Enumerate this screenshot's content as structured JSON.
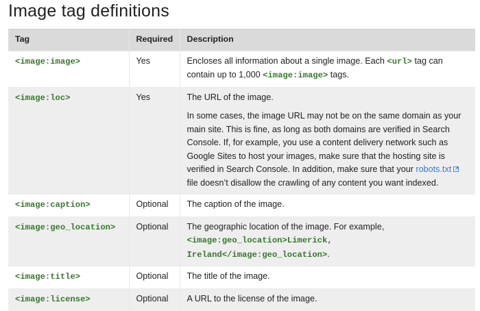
{
  "heading": "Image tag definitions",
  "columns": {
    "tag": "Tag",
    "required": "Required",
    "description": "Description"
  },
  "rows": {
    "image": {
      "tag": "<image:image>",
      "required": "Yes",
      "desc": {
        "a": "Encloses all information about a single image. Each ",
        "code1": "<url>",
        "b": " tag can contain up to 1,000 ",
        "code2": "<image:image>",
        "c": " tags."
      }
    },
    "loc": {
      "tag": "<image:loc>",
      "required": "Yes",
      "p1": "The URL of the image.",
      "p2": "In some cases, the image URL may not be on the same domain as your main site. This is fine, as long as both domains are verified in Search Console. If, for example, you use a content delivery network such as Google Sites to host your images, make sure that the hosting site is verified in Search Console. In addition, make sure that your ",
      "link": "robots.txt",
      "p2_end": " file doesn’t disallow the crawling of any content you want indexed."
    },
    "caption": {
      "tag": "<image:caption>",
      "required": "Optional",
      "desc": "The caption of the image."
    },
    "geo": {
      "tag": "<image:geo_location>",
      "required": "Optional",
      "desc_a": "The geographic location of the image. For example, ",
      "code": "<image:geo_location>Limerick, Ireland</image:geo_location>",
      "desc_b": "."
    },
    "title": {
      "tag": "<image:title>",
      "required": "Optional",
      "desc": "The title of the image."
    },
    "license": {
      "tag": "<image:license>",
      "required": "Optional",
      "desc": "A URL to the license of the image."
    }
  },
  "icons": {
    "external_link": "external-link-icon"
  },
  "colors": {
    "code": "#37782c",
    "link": "#3a78d3",
    "header_bg": "#dadada",
    "shaded_row": "#eeeeee"
  }
}
